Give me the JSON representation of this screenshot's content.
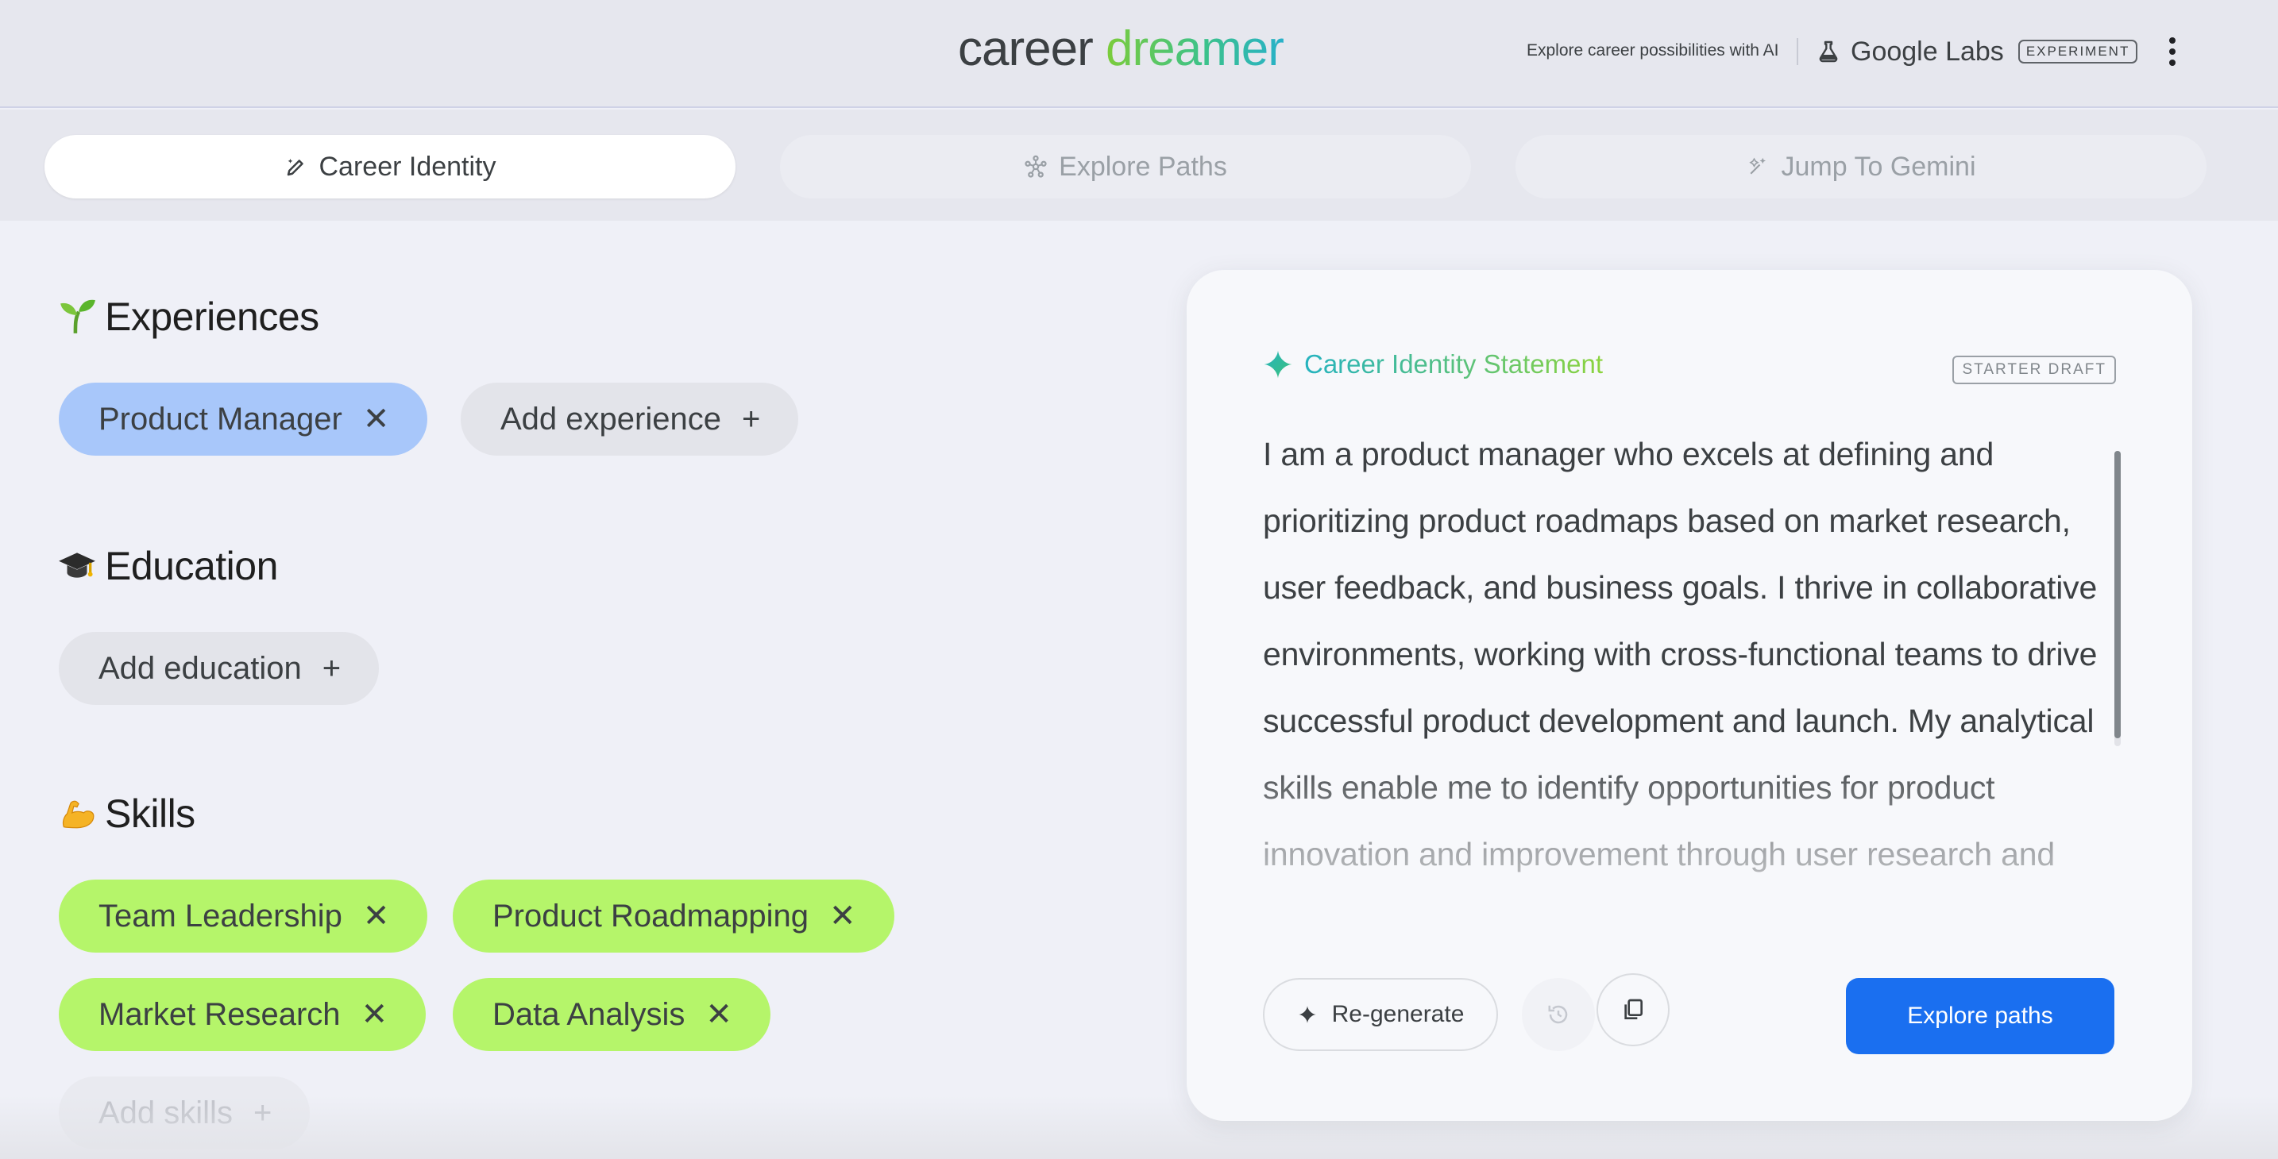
{
  "header": {
    "logo_word1": "career",
    "logo_word2": "dreamer",
    "tagline": "Explore career possibilities with AI",
    "labs_label": "Google Labs",
    "experiment_badge": "EXPERIMENT",
    "menu_icon": "more-vert-icon"
  },
  "tabs": [
    {
      "label": "Career Identity",
      "icon": "edit-sparkle-icon",
      "active": true
    },
    {
      "label": "Explore Paths",
      "icon": "network-icon",
      "active": false
    },
    {
      "label": "Jump To Gemini",
      "icon": "sparkle-arrow-icon",
      "active": false
    }
  ],
  "experiences": {
    "title": "Experiences",
    "emoji": "seedling-emoji",
    "chips": [
      "Product Manager"
    ],
    "add_label": "Add experience"
  },
  "education": {
    "title": "Education",
    "emoji": "graduation-cap-emoji",
    "add_label": "Add education"
  },
  "skills": {
    "title": "Skills",
    "emoji": "flexed-biceps-emoji",
    "chips": [
      "Team Leadership",
      "Product Roadmapping",
      "Market Research",
      "Data Analysis"
    ],
    "add_label": "Add skills"
  },
  "statement_card": {
    "title": "Career Identity Statement",
    "badge": "STARTER DRAFT",
    "text": "I am a product manager who excels at defining and prioritizing product roadmaps based on market research, user feedback, and business goals. I thrive in collaborative environments, working with cross-functional teams to drive successful product development and launch. My analytical skills enable me to identify opportunities for product innovation and improvement through user research and data analysis. I am also adept at developing",
    "regenerate_label": "Re-generate",
    "history_icon": "history-icon",
    "copy_icon": "copy-icon",
    "explore_label": "Explore paths"
  },
  "colors": {
    "accent_blue": "#1a6ff0",
    "experience_chip": "#a8c7fa",
    "skill_chip": "#b5f56a"
  }
}
